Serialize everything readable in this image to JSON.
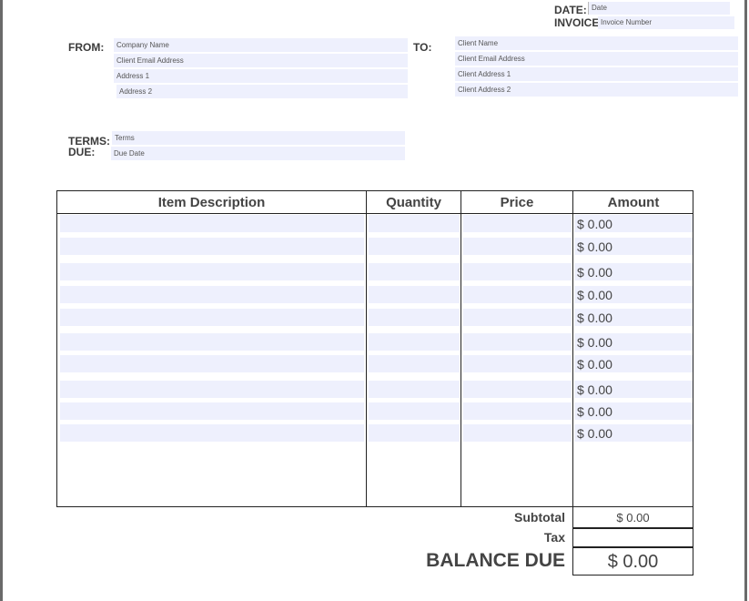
{
  "header": {
    "date_label": "DATE:",
    "date_value": "Date",
    "invoice_label": "INVOICE",
    "invoice_value": "Invoice Number"
  },
  "from": {
    "label": "FROM:",
    "fields": [
      "Company Name",
      "Client Email Address",
      "Address 1",
      "Address 2"
    ]
  },
  "to": {
    "label": "TO:",
    "fields": [
      "Client Name",
      "Client Email Address",
      "Client Address 1",
      "Client Address 2"
    ]
  },
  "terms": {
    "terms_label": "TERMS:",
    "due_label": "DUE:",
    "terms_value": "Terms",
    "due_value": "Due Date"
  },
  "table": {
    "headers": [
      "Item Description",
      "Quantity",
      "Price",
      "Amount"
    ],
    "amounts": [
      "$ 0.00",
      "$ 0.00",
      "$ 0.00",
      "$ 0.00",
      "$ 0.00",
      "$ 0.00",
      "$ 0.00",
      "$ 0.00",
      "$ 0.00",
      "$ 0.00"
    ]
  },
  "totals": {
    "subtotal_label": "Subtotal",
    "subtotal_value": "$ 0.00",
    "tax_label": "Tax",
    "tax_value": "",
    "balance_label": "BALANCE DUE",
    "balance_value": "$ 0.00"
  }
}
